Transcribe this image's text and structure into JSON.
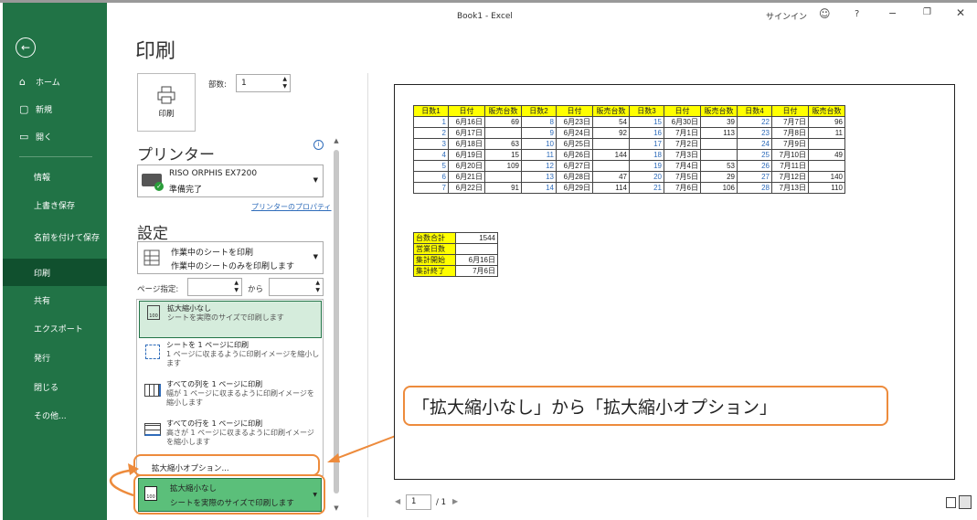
{
  "window": {
    "title": "Book1  -  Excel",
    "signin": "サインイン",
    "help": "?"
  },
  "sidebar": {
    "back": "←",
    "items": [
      {
        "label": "ホーム",
        "icon": "⌂"
      },
      {
        "label": "新規",
        "icon": "▢"
      },
      {
        "label": "開く",
        "icon": "▭"
      },
      {
        "label": "情報"
      },
      {
        "label": "上書き保存"
      },
      {
        "label": "名前を付けて保存"
      },
      {
        "label": "印刷",
        "selected": true
      },
      {
        "label": "共有"
      },
      {
        "label": "エクスポート"
      },
      {
        "label": "発行"
      },
      {
        "label": "閉じる"
      },
      {
        "label": "その他..."
      }
    ]
  },
  "print": {
    "heading": "印刷",
    "button": "印刷",
    "copies_label": "部数:",
    "copies_value": "1"
  },
  "printer": {
    "title": "プリンター",
    "name": "RISO ORPHIS EX7200",
    "status": "準備完了",
    "properties": "プリンターのプロパティ"
  },
  "settings": {
    "title": "設定",
    "scope_main": "作業中のシートを印刷",
    "scope_sub": "作業中のシートのみを印刷します",
    "pages_label": "ページ指定:",
    "pages_to": "から",
    "pages_from_value": "",
    "pages_to_value": ""
  },
  "scaling_options": [
    {
      "title": "拡大縮小なし",
      "desc": "シートを実際のサイズで印刷します"
    },
    {
      "title": "シートを 1 ページに印刷",
      "desc": "1 ページに収まるように印刷イメージを縮小します"
    },
    {
      "title": "すべての列を 1 ページに印刷",
      "desc": "幅が 1 ページに収まるように印刷イメージを縮小します"
    },
    {
      "title": "すべての行を 1 ページに印刷",
      "desc": "高さが 1 ページに収まるように印刷イメージを縮小します"
    }
  ],
  "custom_scaling": "拡大縮小オプション...",
  "scaling_current": {
    "title": "拡大縮小なし",
    "desc": "シートを実際のサイズで印刷します",
    "badge": "100"
  },
  "preview": {
    "headers": [
      "日数1",
      "日付",
      "販売台数",
      "日数2",
      "日付",
      "販売台数",
      "日数3",
      "日付",
      "販売台数",
      "日数4",
      "日付",
      "販売台数"
    ],
    "rows": [
      [
        "1",
        "6月16日",
        "69",
        "8",
        "6月23日",
        "54",
        "15",
        "6月30日",
        "39",
        "22",
        "7月7日",
        "96"
      ],
      [
        "2",
        "6月17日",
        "",
        "9",
        "6月24日",
        "92",
        "16",
        "7月1日",
        "113",
        "23",
        "7月8日",
        "11"
      ],
      [
        "3",
        "6月18日",
        "63",
        "10",
        "6月25日",
        "",
        "17",
        "7月2日",
        "",
        "24",
        "7月9日",
        ""
      ],
      [
        "4",
        "6月19日",
        "15",
        "11",
        "6月26日",
        "144",
        "18",
        "7月3日",
        "",
        "25",
        "7月10日",
        "49"
      ],
      [
        "5",
        "6月20日",
        "109",
        "12",
        "6月27日",
        "",
        "19",
        "7月4日",
        "53",
        "26",
        "7月11日",
        ""
      ],
      [
        "6",
        "6月21日",
        "",
        "13",
        "6月28日",
        "47",
        "20",
        "7月5日",
        "29",
        "27",
        "7月12日",
        "140"
      ],
      [
        "7",
        "6月22日",
        "91",
        "14",
        "6月29日",
        "114",
        "21",
        "7月6日",
        "106",
        "28",
        "7月13日",
        "110"
      ]
    ],
    "summary": [
      [
        "台数合計",
        "1544"
      ],
      [
        "営業日数",
        ""
      ],
      [
        "集計開始",
        "6月16日"
      ],
      [
        "集計終了",
        "7月6日"
      ]
    ],
    "page_current": "1",
    "page_total": "/ 1"
  },
  "callout_text": "「拡大縮小なし」から「拡大縮小オプション」",
  "colors": {
    "accent": "#217346",
    "callout": "#ed8b3c",
    "header_fill": "#ffff00"
  }
}
